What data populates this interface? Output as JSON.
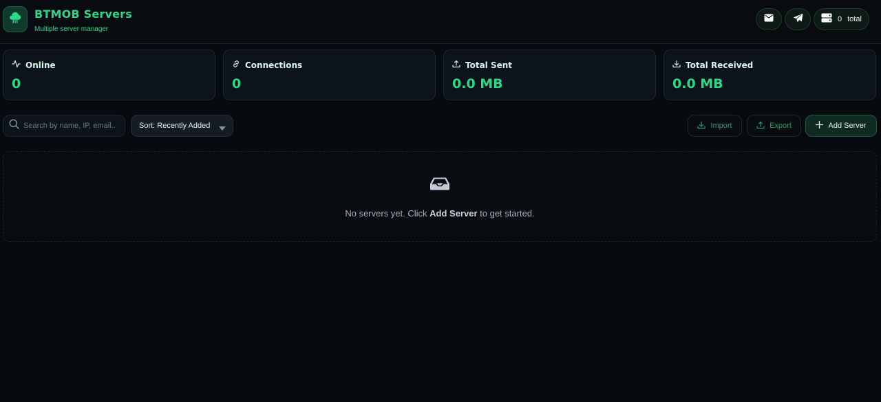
{
  "header": {
    "title": "BTMOB Servers",
    "subtitle": "Multiple server manager",
    "total_count": "0",
    "total_label": "total",
    "icons": [
      "cloud-logo-icon",
      "mail-icon",
      "telegram-icon",
      "server-icon"
    ]
  },
  "stats": [
    {
      "label": "Online",
      "value": "0",
      "icon": "activity-icon"
    },
    {
      "label": "Connections",
      "value": "0",
      "icon": "link-icon"
    },
    {
      "label": "Total Sent",
      "value": "0.0 MB",
      "icon": "upload-icon"
    },
    {
      "label": "Total Received",
      "value": "0.0 MB",
      "icon": "download-icon"
    }
  ],
  "toolbar": {
    "search_placeholder": "Search by name, IP, email...",
    "sort_label": "Sort: Recently Added",
    "import_label": "Import",
    "export_label": "Export",
    "add_label": "Add Server"
  },
  "empty_state": {
    "prefix": "No servers yet. Click ",
    "emphasis": "Add Server",
    "suffix": " to get started.",
    "icon": "inbox-icon"
  },
  "colors": {
    "accent": "#2bd98a",
    "background": "#070a0e",
    "card": "#0d131a"
  }
}
